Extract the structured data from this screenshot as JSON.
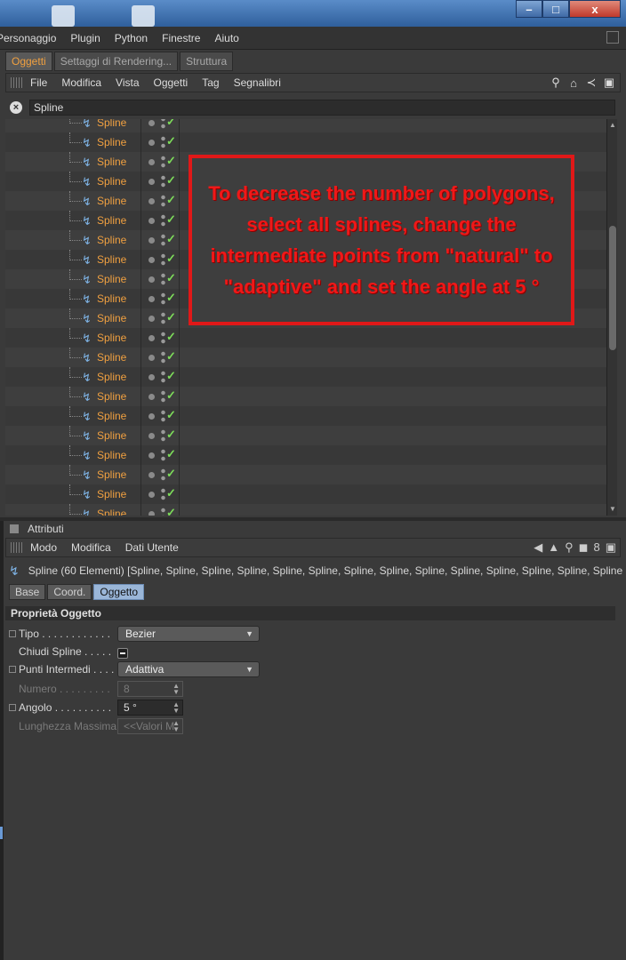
{
  "window": {
    "minimize": "–",
    "maximize": "□",
    "close": "x"
  },
  "menubar": {
    "items": [
      "Personaggio",
      "Plugin",
      "Python",
      "Finestre",
      "Aiuto"
    ]
  },
  "tabs": [
    {
      "label": "Oggetti",
      "active": true
    },
    {
      "label": "Settaggi di Rendering...",
      "active": false
    },
    {
      "label": "Struttura",
      "active": false
    }
  ],
  "om_menu": {
    "items": [
      "File",
      "Modifica",
      "Vista",
      "Oggetti",
      "Tag",
      "Segnalibri"
    ]
  },
  "search": {
    "value": "Spline"
  },
  "objects": {
    "name": "Spline",
    "count": 21
  },
  "annotation": "To decrease the number of polygons, select all splines, change the intermediate points from \"natural\" to \"adaptive\" and set the angle at 5 °",
  "attributes": {
    "title": "Attributi",
    "menu": [
      "Modo",
      "Modifica",
      "Dati Utente"
    ],
    "selection_info": "Spline (60 Elementi) [Spline, Spline, Spline, Spline, Spline, Spline, Spline, Spline, Spline, Spline, Spline, Spline, Spline, Spline, Sp",
    "subtabs": [
      {
        "label": "Base",
        "active": false
      },
      {
        "label": "Coord.",
        "active": false
      },
      {
        "label": "Oggetto",
        "active": true
      }
    ],
    "section_title": "Proprietà Oggetto",
    "props": {
      "tipo": {
        "label": "Tipo . . . . . . . . . . . .",
        "value": "Bezier"
      },
      "chiudi": {
        "label": "Chiudi Spline . . . . .",
        "value": "-"
      },
      "punti": {
        "label": "Punti Intermedi . . . .",
        "value": "Adattiva"
      },
      "numero": {
        "label": "Numero . . . . . . . . .",
        "value": "8"
      },
      "angolo": {
        "label": "Angolo . . . . . . . . . .",
        "value": "5 °"
      },
      "lunghezza": {
        "label": "Lunghezza Massima",
        "value": "<<Valori M"
      }
    }
  },
  "colors": {
    "accent_orange": "#f0a040",
    "annotation_red": "#e01818",
    "check_green": "#7ddc5a"
  }
}
